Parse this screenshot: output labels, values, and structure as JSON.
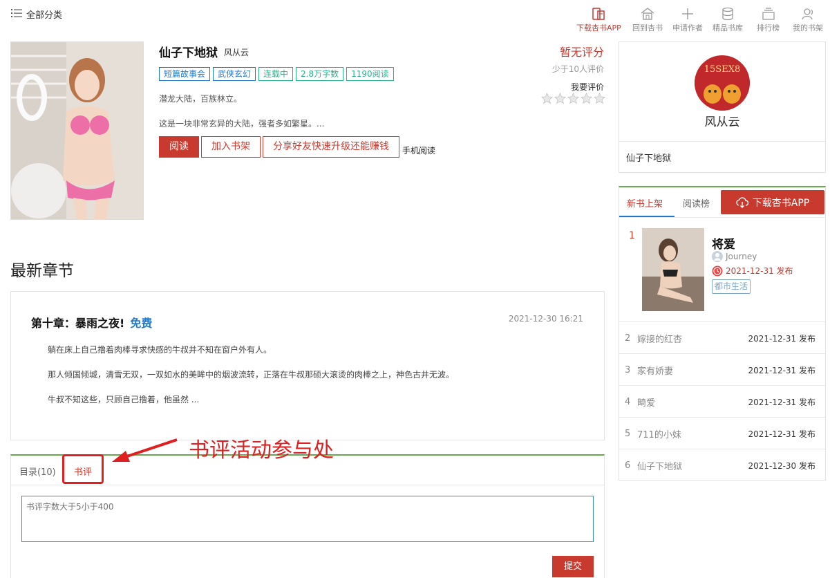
{
  "topbar": {
    "category": "全部分类",
    "nav": [
      {
        "label": "下载杏书APP",
        "icon": "phone-book-icon"
      },
      {
        "label": "回到杏书",
        "icon": "home-icon"
      },
      {
        "label": "申请作者",
        "icon": "plus-icon"
      },
      {
        "label": "精品书库",
        "icon": "database-icon"
      },
      {
        "label": "排行榜",
        "icon": "stack-icon"
      },
      {
        "label": "我的书架",
        "icon": "user-icon"
      }
    ]
  },
  "book": {
    "title": "仙子下地狱",
    "author": "风从云",
    "tags": [
      "短篇故事会",
      "武侠玄幻",
      "连载中",
      "2.8万字数",
      "1190阅读"
    ],
    "intro1": "潜龙大陆，百族林立。",
    "intro2": "这是一块非常玄异的大陆，强者多如繁星。...",
    "buttons": {
      "read": "阅读",
      "add_shelf": "加入书架",
      "share": "分享好友快速升级还能赚钱",
      "mobile": "手机阅读"
    },
    "rating": {
      "status": "暂无评分",
      "count_text": "少于10人评价",
      "my_rate": "我要评价",
      "stars": 5
    }
  },
  "latest": {
    "heading": "最新章节",
    "chapter_title": "第十章：暴雨之夜!",
    "free": "免费",
    "date": "2021-12-30 16:21",
    "paragraphs": [
      "躺在床上自己撸着肉棒寻求快感的牛叔并不知在窗户外有人。",
      "那人倾国倾城，清雪无双，一双如水的美眸中的烟波流转，正落在牛叔那硕大滚烫的肉棒之上，神色古井无波。",
      "牛叔不知这些，只顾自己撸着，他虽然 ..."
    ]
  },
  "comments": {
    "tab_toc": "目录(10)",
    "tab_review": "书评",
    "annotation": "书评活动参与处",
    "placeholder": "书评字数大于5小于400",
    "submit": "提交"
  },
  "author_card": {
    "name": "风从云",
    "book": "仙子下地狱",
    "avatar_text": "15SEX8"
  },
  "ranking": {
    "tab_new": "新书上架",
    "tab_read": "阅读榜",
    "download": "下载杏书APP",
    "top": {
      "rank": "1",
      "title": "将爱",
      "author": "Journey",
      "date": "2021-12-31 发布",
      "tag": "都市生活"
    },
    "items": [
      {
        "rank": "2",
        "title": "嫁接的红杏",
        "date": "2021-12-31 发布"
      },
      {
        "rank": "3",
        "title": "家有娇妻",
        "date": "2021-12-31 发布"
      },
      {
        "rank": "4",
        "title": "畸爱",
        "date": "2021-12-31 发布"
      },
      {
        "rank": "5",
        "title": "711的小妹",
        "date": "2021-12-31 发布"
      },
      {
        "rank": "6",
        "title": "仙子下地狱",
        "date": "2021-12-30 发布"
      }
    ]
  }
}
